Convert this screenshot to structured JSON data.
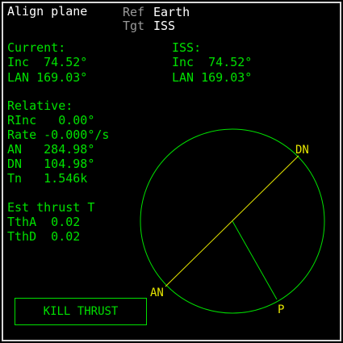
{
  "header": {
    "title": "Align plane",
    "ref_label": "Ref",
    "ref_value": "Earth",
    "tgt_label": "Tgt",
    "tgt_value": "ISS"
  },
  "current": {
    "heading": "Current:",
    "inc": "Inc  74.52°",
    "lan": "LAN 169.03°"
  },
  "target": {
    "heading": "ISS:",
    "inc": "Inc  74.52°",
    "lan": "LAN 169.03°"
  },
  "relative": {
    "heading": "Relative:",
    "rinc": "RInc   0.00°",
    "rate": "Rate -0.000°/s",
    "an": "AN   284.98°",
    "dn": "DN   104.98°",
    "tn": "Tn   1.546k"
  },
  "thrust": {
    "heading": "Est thrust T",
    "ttha": "TthA  0.02",
    "tthd": "TthD  0.02"
  },
  "kill_button": {
    "label": "KILL THRUST"
  },
  "diagram": {
    "an_label": "AN",
    "dn_label": "DN",
    "p_label": "P",
    "an_angle_deg": 284.98,
    "dn_angle_deg": 104.98,
    "circle_color": "#00e100",
    "node_line_color": "#e6e600"
  }
}
